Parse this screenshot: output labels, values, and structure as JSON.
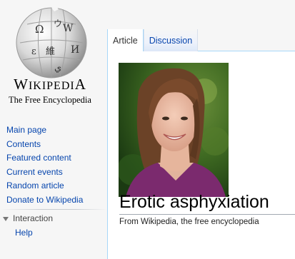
{
  "logo": {
    "wordmark_first": "W",
    "wordmark_rest": "IKIPEDI",
    "wordmark_last": "A",
    "tagline": "The Free Encyclopedia",
    "glyphs": [
      "Ω",
      "W",
      "И",
      "維",
      "ウ",
      "ε",
      "ي"
    ]
  },
  "nav": {
    "items": [
      {
        "label": "Main page",
        "name": "nav-main-page"
      },
      {
        "label": "Contents",
        "name": "nav-contents"
      },
      {
        "label": "Featured content",
        "name": "nav-featured-content"
      },
      {
        "label": "Current events",
        "name": "nav-current-events"
      },
      {
        "label": "Random article",
        "name": "nav-random-article"
      },
      {
        "label": "Donate to Wikipedia",
        "name": "nav-donate"
      }
    ],
    "portal_heading": "Interaction",
    "portal_items": [
      {
        "label": "Help"
      }
    ]
  },
  "tabs": [
    {
      "label": "Article",
      "active": true
    },
    {
      "label": "Discussion",
      "active": false
    }
  ],
  "article": {
    "title": "Erotic asphyxiation",
    "subtitle": "From Wikipedia, the free encyclopedia"
  },
  "colors": {
    "link": "#0645ad",
    "tab_border": "#a7d7f9",
    "sidebar_bg": "#f6f6f6"
  }
}
